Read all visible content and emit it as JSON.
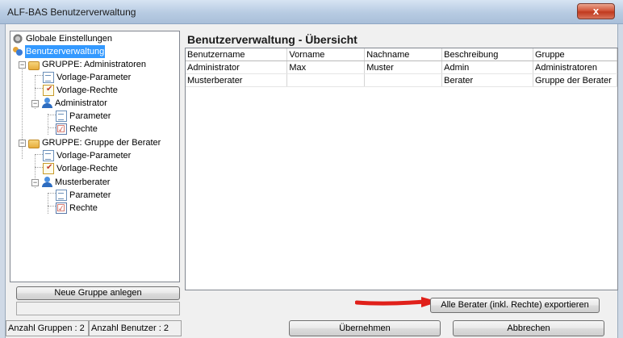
{
  "window": {
    "title": "ALF-BAS Benutzerverwaltung",
    "close_symbol": "x"
  },
  "tree": {
    "root_global": "Globale Einstellungen",
    "root_users": "Benutzerverwaltung",
    "group1": {
      "label": "GRUPPE: Administratoren",
      "vorlage_parameter": "Vorlage-Parameter",
      "vorlage_rechte": "Vorlage-Rechte",
      "user": {
        "label": "Administrator",
        "parameter": "Parameter",
        "rechte": "Rechte"
      }
    },
    "group2": {
      "label": "GRUPPE: Gruppe der Berater",
      "vorlage_parameter": "Vorlage-Parameter",
      "vorlage_rechte": "Vorlage-Rechte",
      "user": {
        "label": "Musterberater",
        "parameter": "Parameter",
        "rechte": "Rechte"
      }
    },
    "expander_symbol": "−"
  },
  "left": {
    "new_group_button": "Neue Gruppe anlegen"
  },
  "main": {
    "heading": "Benutzerverwaltung - Übersicht",
    "columns": [
      "Benutzername",
      "Vorname",
      "Nachname",
      "Beschreibung",
      "Gruppe"
    ],
    "rows": [
      [
        "Administrator",
        "Max",
        "Muster",
        "Admin",
        "Administratoren"
      ],
      [
        "Musterberater",
        "",
        "",
        "Berater",
        "Gruppe der Berater"
      ]
    ],
    "export_button": "Alle Berater (inkl. Rechte) exportieren"
  },
  "status": {
    "groups": "Anzahl Gruppen : 2",
    "users": "Anzahl Benutzer : 2"
  },
  "footer": {
    "apply_button": "Übernehmen",
    "cancel_button": "Abbrechen"
  },
  "colors": {
    "selection": "#3399ff",
    "arrow": "#e0201a"
  }
}
